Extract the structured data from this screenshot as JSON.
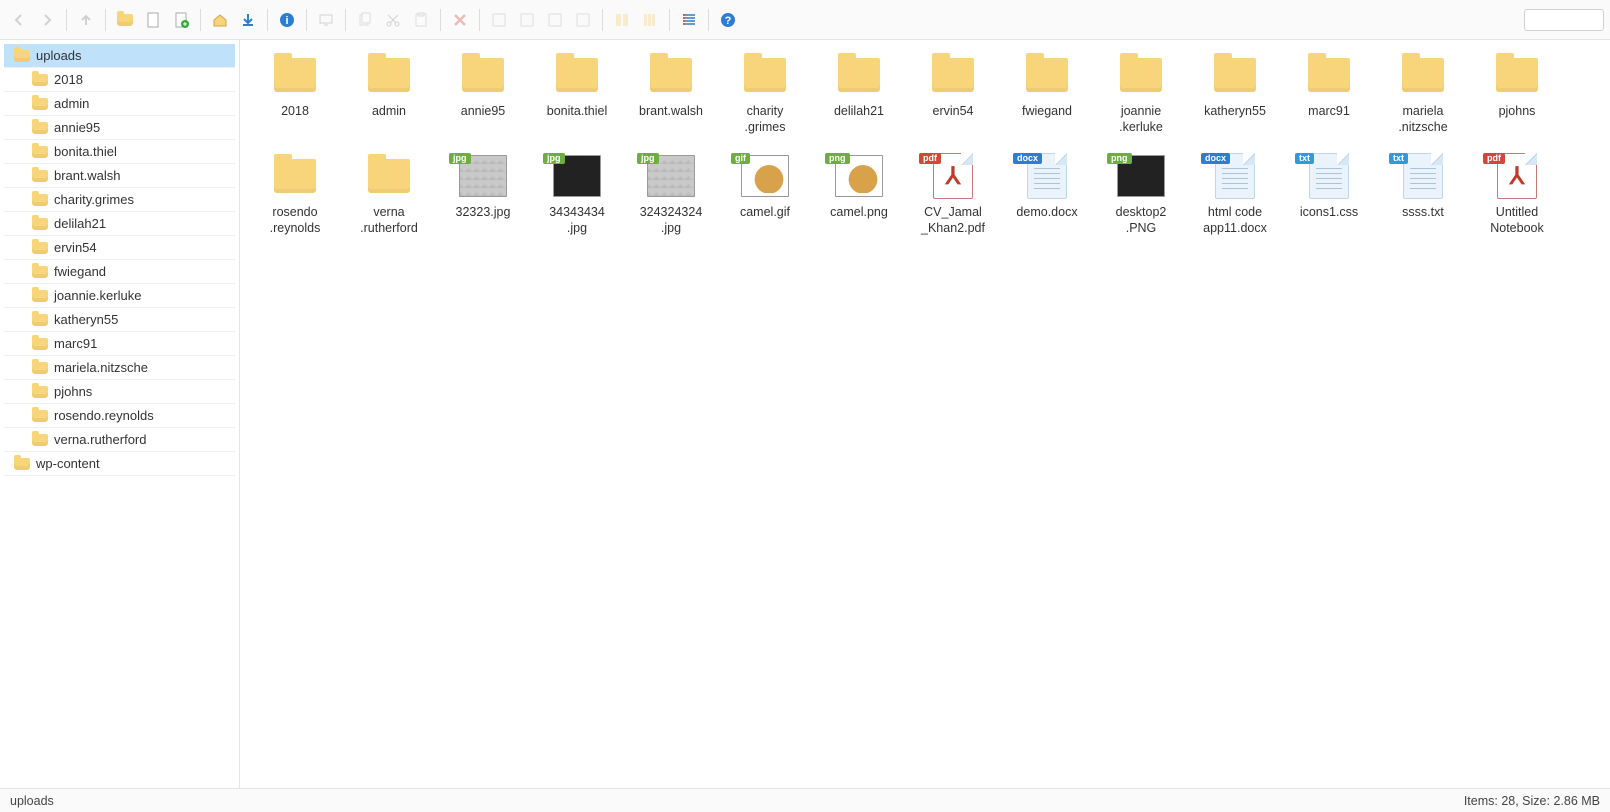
{
  "toolbar": {
    "back": "Back",
    "forward": "Forward",
    "up": "Up"
  },
  "tree": {
    "root": "uploads",
    "children": [
      "2018",
      "admin",
      "annie95",
      "bonita.thiel",
      "brant.walsh",
      "charity.grimes",
      "delilah21",
      "ervin54",
      "fwiegand",
      "joannie.kerluke",
      "katheryn55",
      "marc91",
      "mariela.nitzsche",
      "pjohns",
      "rosendo.reynolds",
      "verna.rutherford"
    ],
    "sibling": "wp-content"
  },
  "items": [
    {
      "name": "2018",
      "type": "folder"
    },
    {
      "name": "admin",
      "type": "folder"
    },
    {
      "name": "annie95",
      "type": "folder"
    },
    {
      "name": "bonita.thiel",
      "type": "folder"
    },
    {
      "name": "brant.walsh",
      "type": "folder"
    },
    {
      "name": "charity\n.grimes",
      "type": "folder"
    },
    {
      "name": "delilah21",
      "type": "folder"
    },
    {
      "name": "ervin54",
      "type": "folder"
    },
    {
      "name": "fwiegand",
      "type": "folder"
    },
    {
      "name": "joannie\n.kerluke",
      "type": "folder"
    },
    {
      "name": "katheryn55",
      "type": "folder"
    },
    {
      "name": "marc91",
      "type": "folder"
    },
    {
      "name": "mariela\n.nitzsche",
      "type": "folder"
    },
    {
      "name": "pjohns",
      "type": "folder"
    },
    {
      "name": "rosendo\n.reynolds",
      "type": "folder"
    },
    {
      "name": "verna\n.rutherford",
      "type": "folder"
    },
    {
      "name": "32323.jpg",
      "type": "image",
      "badge": "jpg"
    },
    {
      "name": "34343434\n.jpg",
      "type": "image",
      "badge": "jpg",
      "variant": "dark"
    },
    {
      "name": "324324324\n.jpg",
      "type": "image",
      "badge": "jpg"
    },
    {
      "name": "camel.gif",
      "type": "image",
      "badge": "gif",
      "variant": "camel"
    },
    {
      "name": "camel.png",
      "type": "image",
      "badge": "png",
      "variant": "camel"
    },
    {
      "name": "CV_Jamal\n_Khan2.pdf",
      "type": "pdf",
      "badge": "pdf"
    },
    {
      "name": "demo.docx",
      "type": "file",
      "badge": "docx"
    },
    {
      "name": "desktop2\n.PNG",
      "type": "image",
      "badge": "png",
      "variant": "dark"
    },
    {
      "name": "html code\napp11.docx",
      "type": "file",
      "badge": "docx"
    },
    {
      "name": "icons1.css",
      "type": "file",
      "badge": "txt"
    },
    {
      "name": "ssss.txt",
      "type": "file",
      "badge": "txt"
    },
    {
      "name": "Untitled\nNotebook",
      "type": "pdf",
      "badge": "pdf"
    }
  ],
  "status": {
    "path": "uploads",
    "summary": "Items: 28, Size: 2.86 MB"
  }
}
